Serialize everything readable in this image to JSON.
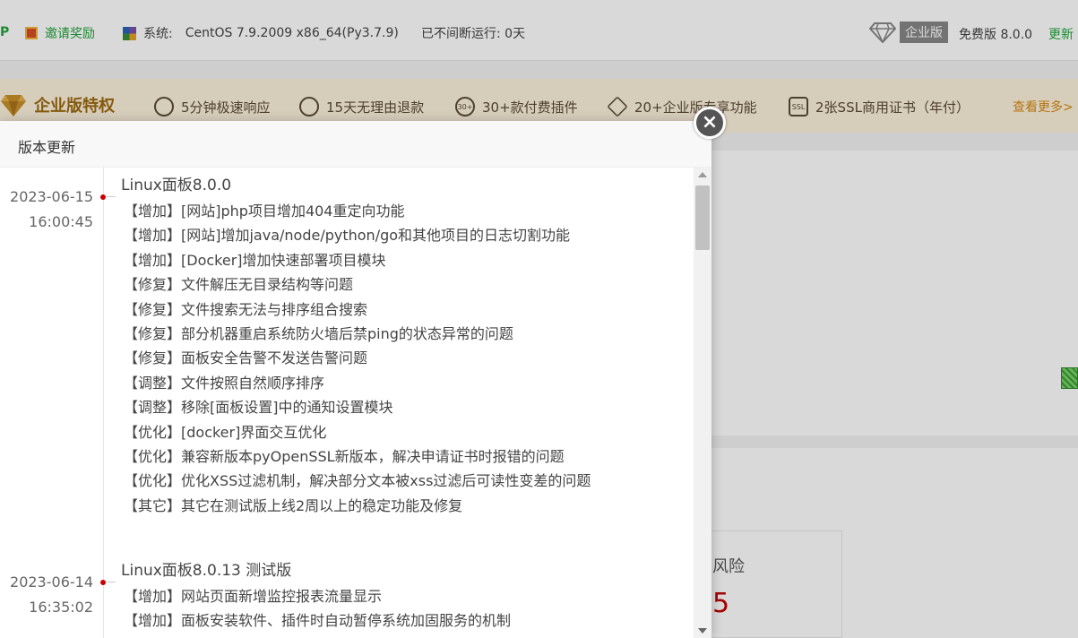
{
  "topbar": {
    "partial_left": "P",
    "invite": "邀请奖励",
    "system_label": "系统:",
    "system_value": "CentOS 7.9.2009 x86_64(Py3.7.9)",
    "uptime": "已不间断运行: 0天",
    "enterprise_badge": "企业版",
    "free_version": "免费版 8.0.0",
    "update_partial": "更新"
  },
  "banner": {
    "title": "企业版特权",
    "features": [
      "5分钟极速响应",
      "15天无理由退款",
      "30+款付费插件",
      "20+企业版专享功能",
      "2张SSL商用证书（年付）"
    ],
    "feature_icon_labels": [
      "",
      "",
      "30+",
      "",
      "SSL"
    ],
    "see_more": "查看更多>"
  },
  "background": {
    "risk_label": "风险",
    "risk_value": "5"
  },
  "modal": {
    "title": "版本更新",
    "close_symbol": "×",
    "entries": [
      {
        "date": "2023-06-15",
        "time": "16:00:45",
        "title": "Linux面板8.0.0",
        "items": [
          "【增加】[网站]php项目增加404重定向功能",
          "【增加】[网站]增加java/node/python/go和其他项目的日志切割功能",
          "【增加】[Docker]增加快速部署项目模块",
          "【修复】文件解压无目录结构等问题",
          "【修复】文件搜索无法与排序组合搜索",
          "【修复】部分机器重启系统防火墙后禁ping的状态异常的问题",
          "【修复】面板安全告警不发送告警问题",
          "【调整】文件按照自然顺序排序",
          "【调整】移除[面板设置]中的通知设置模块",
          "【优化】[docker]界面交互优化",
          "【优化】兼容新版本pyOpenSSL新版本，解决申请证书时报错的问题",
          "【优化】优化XSS过滤机制，解决部分文本被xss过滤后可读性变差的问题",
          "【其它】其它在测试版上线2周以上的稳定功能及修复"
        ]
      },
      {
        "date": "2023-06-14",
        "time": "16:35:02",
        "title": "Linux面板8.0.13 测试版",
        "items": [
          "【增加】网站页面新增监控报表流量显示",
          "【增加】面板安装软件、插件时自动暂停系统加固服务的机制"
        ]
      }
    ]
  },
  "colors": {
    "brand_green": "#20a53a",
    "banner_bg": "#fdf1dc",
    "banner_title": "#9c6a12",
    "see_more": "#d78a12",
    "dot_red": "#cc0000",
    "risk_red": "#c40000"
  }
}
